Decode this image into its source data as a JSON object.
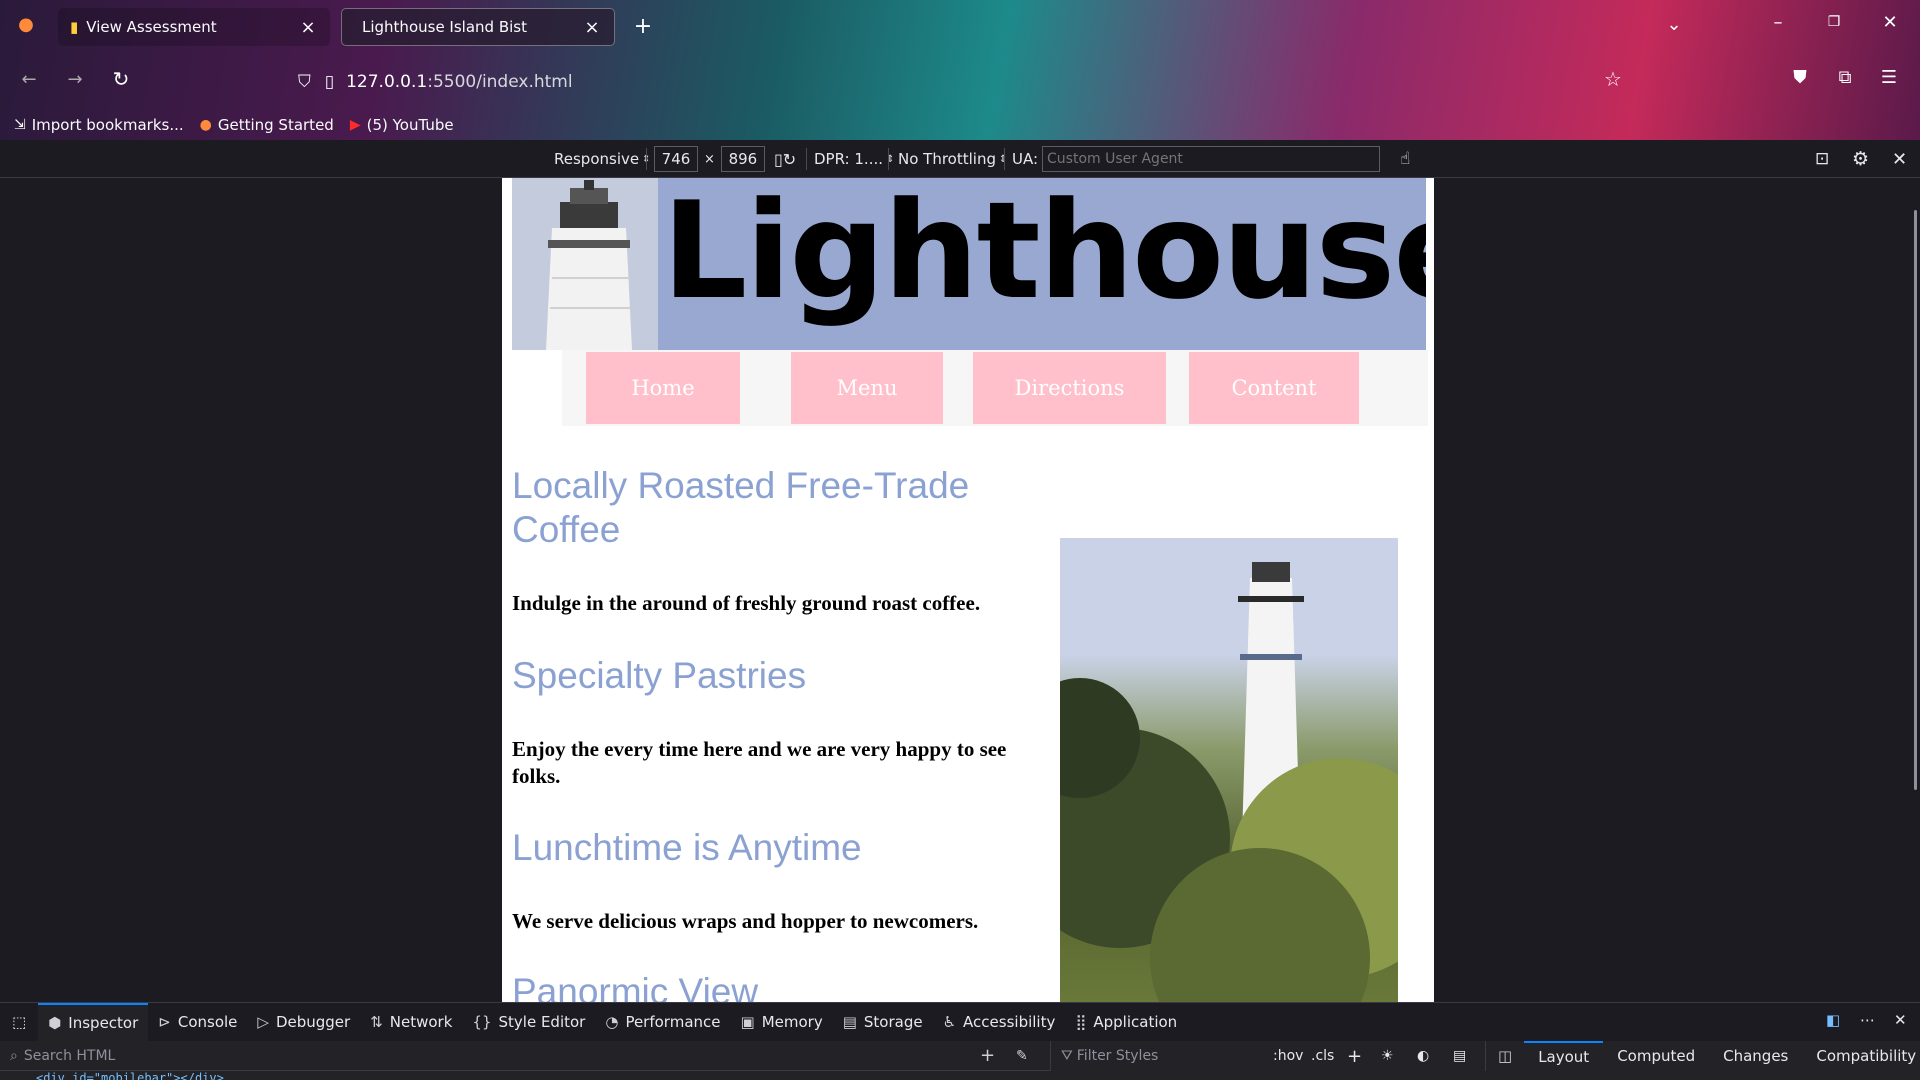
{
  "browser": {
    "tabs": [
      {
        "title": "View Assessment"
      },
      {
        "title": "Lighthouse Island Bist"
      }
    ],
    "url_host": "127.0.0.1",
    "url_path": ":5500/index.html",
    "bookmarks": [
      {
        "label": "Import bookmarks..."
      },
      {
        "label": "Getting Started"
      },
      {
        "label": "(5) YouTube"
      }
    ]
  },
  "rdm": {
    "device": "Responsive",
    "width": "746",
    "times": "×",
    "height": "896",
    "dpr": "DPR: 1....",
    "throttling": "No Throttling",
    "ua_label": "UA:",
    "ua_placeholder": "Custom User Agent"
  },
  "site": {
    "title": "Lighthouse",
    "nav": [
      "Home",
      "Menu",
      "Directions",
      "Content"
    ],
    "sections": [
      {
        "heading": "Locally Roasted Free-Trade Coffee",
        "text": "Indulge in the around of freshly ground roast coffee."
      },
      {
        "heading": "Specialty Pastries",
        "text": "Enjoy the every time here and we are very happy to see folks."
      },
      {
        "heading": "Lunchtime is Anytime",
        "text": "We serve delicious wraps and hopper to newcomers."
      },
      {
        "heading": "Panormic View"
      }
    ]
  },
  "devtools": {
    "tabs": [
      "Inspector",
      "Console",
      "Debugger",
      "Network",
      "Style Editor",
      "Performance",
      "Memory",
      "Storage",
      "Accessibility",
      "Application"
    ],
    "search_placeholder": "Search HTML",
    "filter_placeholder": "Filter Styles",
    "hov": ":hov",
    "cls": ".cls",
    "side_tabs": [
      "Layout",
      "Computed",
      "Changes",
      "Compatibility"
    ],
    "peek": "<div id=\"mobilebar\"></div>"
  },
  "colors": {
    "heading": "#8aa1d2",
    "nav_button": "#ffc0cb",
    "header_bg": "#98a8d0",
    "accent": "#0a84ff"
  }
}
